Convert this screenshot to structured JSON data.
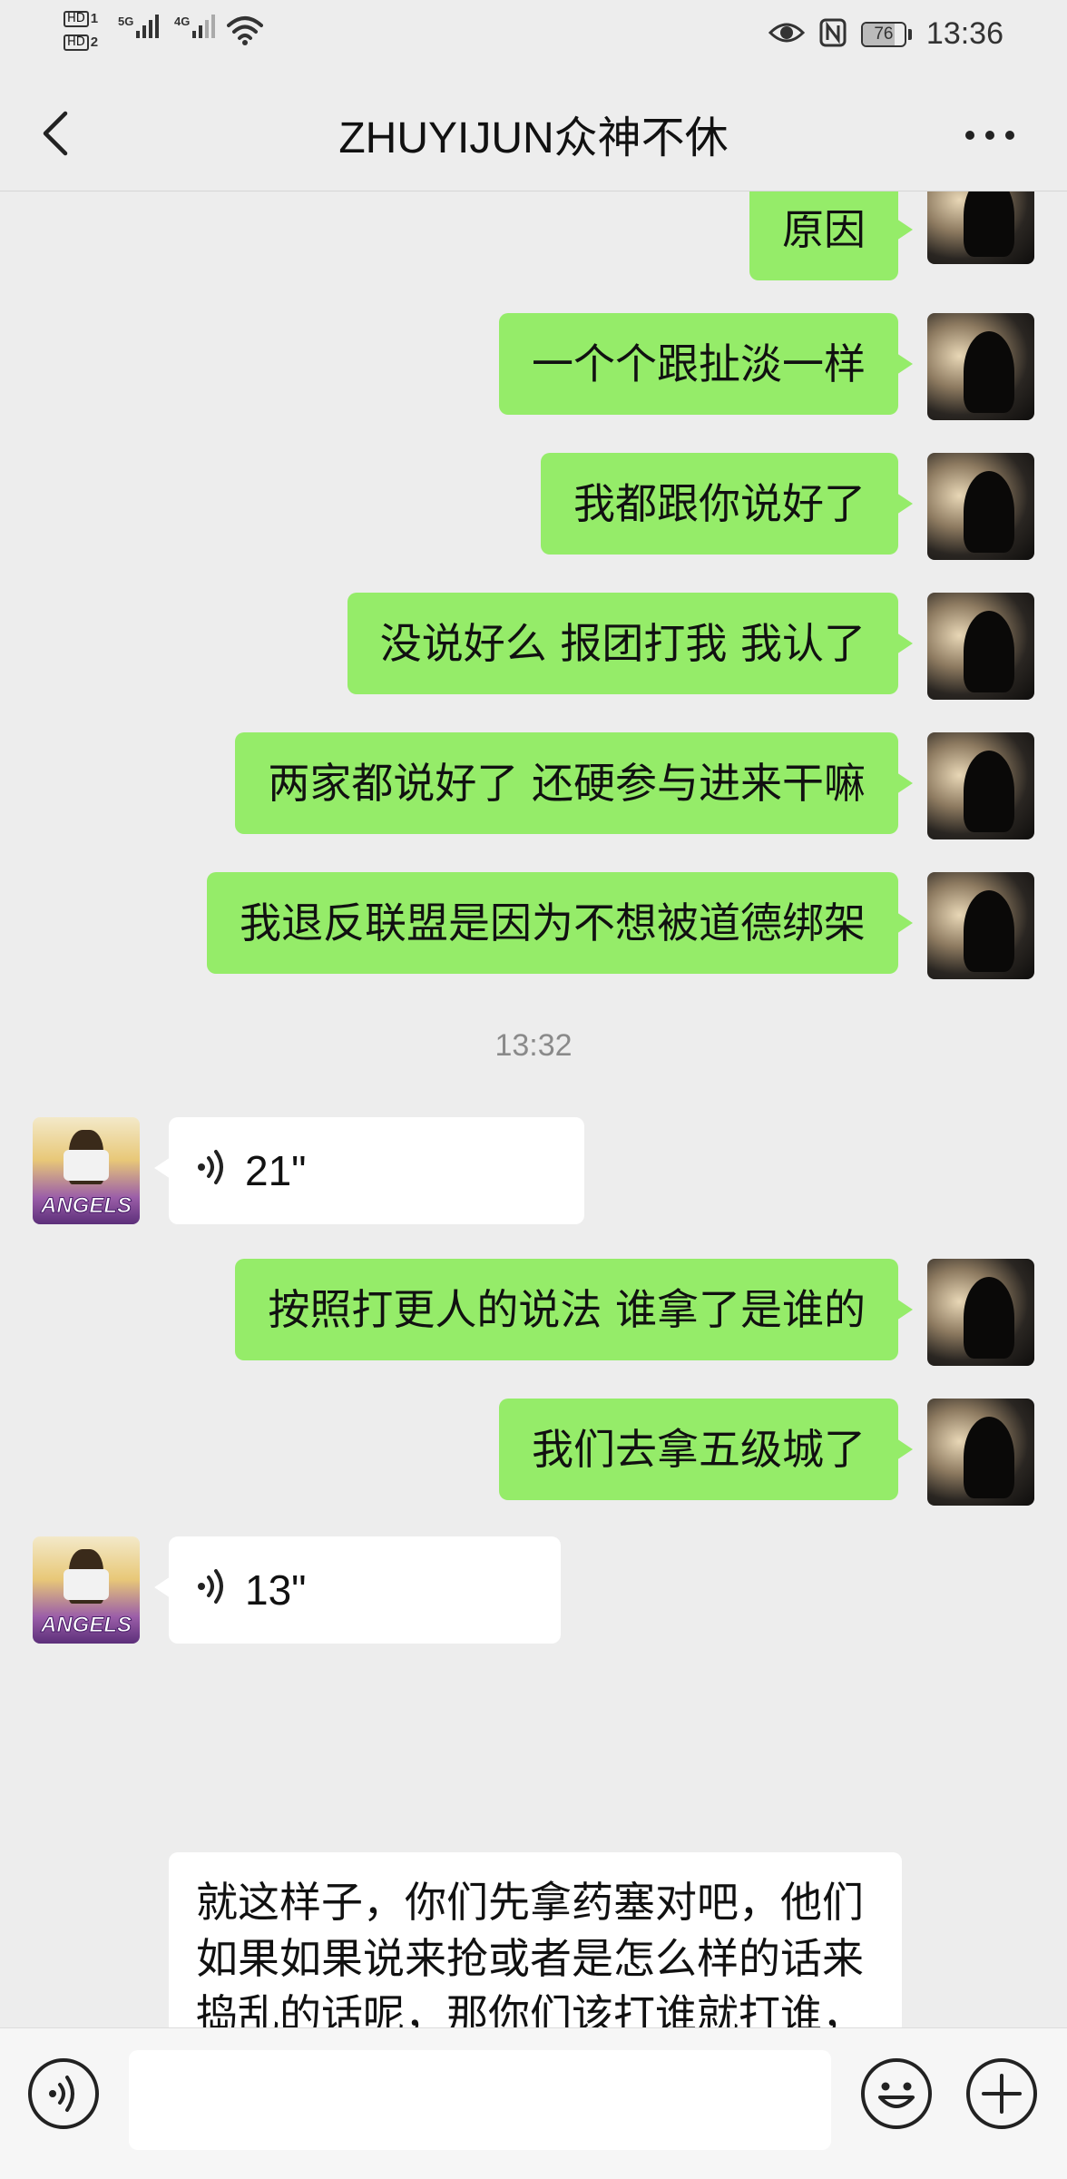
{
  "status_bar": {
    "hd1": "HD",
    "hd1_num": "1",
    "hd2": "HD",
    "hd2_num": "2",
    "net1": "5G",
    "net2": "4G",
    "battery": "76",
    "battery_level": 0.76,
    "time": "13:36",
    "icons": [
      "eye-icon",
      "nfc-icon",
      "battery-icon",
      "wifi-icon",
      "signal-icon"
    ]
  },
  "header": {
    "title": "ZHUYIJUN众神不休",
    "back_icon": "chevron-left-icon",
    "more_icon": "more-dots-icon"
  },
  "messages": [
    {
      "from": "self",
      "type": "text",
      "text": "原因"
    },
    {
      "from": "self",
      "type": "text",
      "text": "一个个跟扯淡一样"
    },
    {
      "from": "self",
      "type": "text",
      "text": "我都跟你说好了"
    },
    {
      "from": "self",
      "type": "text",
      "text": "没说好么 报团打我 我认了"
    },
    {
      "from": "self",
      "type": "text",
      "text": "两家都说好了  还硬参与进来干嘛"
    },
    {
      "from": "self",
      "type": "text",
      "text": "我退反联盟是因为不想被道德绑架"
    },
    {
      "type": "time",
      "text": "13:32"
    },
    {
      "from": "other",
      "type": "voice",
      "text": "21\""
    },
    {
      "from": "self",
      "type": "text",
      "text": "按照打更人的说法 谁拿了是谁的"
    },
    {
      "from": "self",
      "type": "text",
      "text": "我们去拿五级城了"
    },
    {
      "from": "other",
      "type": "voice",
      "text": "13\""
    },
    {
      "from": "other",
      "type": "transcript",
      "text": "就这样子，你们先拿药塞对吧，他们如果如果说来抢或者是怎么样的话来捣乱的话呢，那你们该打谁就打谁，你们自己看着办吧，好了好吧。"
    }
  ],
  "other_avatar_text": "ANGELS",
  "input_bar": {
    "voice_icon": "voice-input-icon",
    "emoji_icon": "emoji-icon",
    "plus_icon": "plus-icon",
    "input_value": ""
  }
}
